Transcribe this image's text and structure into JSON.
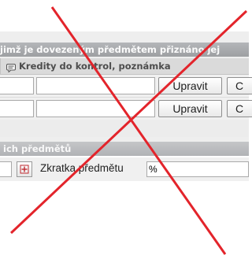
{
  "colors": {
    "cross_line": "#e3242b",
    "header_bar": "#a8aaad",
    "panel_bg": "#eeeeee"
  },
  "header": {
    "title_fragment": "jimž je dovezeným předmětem přiznáno jej"
  },
  "columns": {
    "credits_icon": "note-icon",
    "credits_label": "Kredity do kontrol, poznámka"
  },
  "rows": [
    {
      "edit_label": "Upravit",
      "trailing_letter": "C"
    },
    {
      "edit_label": "Upravit",
      "trailing_letter": "C"
    }
  ],
  "section": {
    "title_fragment": "ich předmětů"
  },
  "filter": {
    "label": "Zkratka předmětu",
    "value": "%"
  }
}
